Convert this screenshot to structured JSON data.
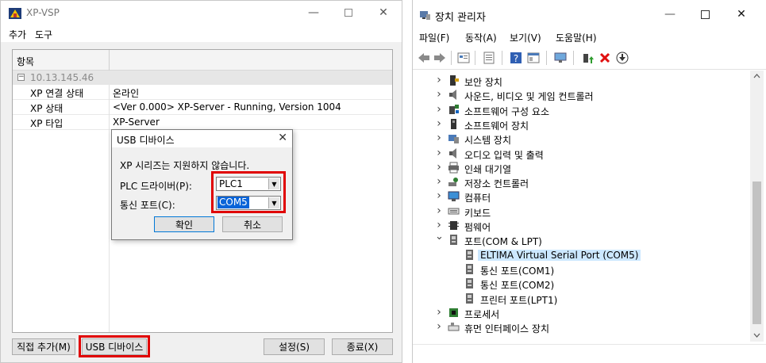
{
  "left": {
    "title": "XP-VSP",
    "menu": [
      "추가",
      "도구"
    ],
    "grid_header": "항목",
    "group": "10.13.145.46",
    "rows": [
      {
        "key": "XP 연결 상태",
        "value": "온라인"
      },
      {
        "key": "XP 상태",
        "value": "<Ver 0.000> XP-Server - Running, Version 1004"
      },
      {
        "key": "XP 타입",
        "value": "XP-Server"
      }
    ],
    "buttons": {
      "direct_add": "직접 추가(M)",
      "usb_device": "USB 디바이스",
      "settings": "설정(S)",
      "exit": "종료(X)"
    },
    "dialog": {
      "title": "USB 디바이스",
      "message": "XP 시리즈는 지원하지 않습니다.",
      "plc_label": "PLC 드라이버(P):",
      "plc_value": "PLC1",
      "port_label": "통신 포트(C):",
      "port_value": "COM5",
      "ok": "확인",
      "cancel": "취소"
    }
  },
  "right": {
    "title": "장치 관리자",
    "menu": [
      "파일(F)",
      "동작(A)",
      "보기(V)",
      "도움말(H)"
    ],
    "tree": [
      {
        "label": "보안 장치",
        "icon": "security-device-icon",
        "level": 0,
        "expand": "collapsed"
      },
      {
        "label": "사운드, 비디오 및 게임 컨트롤러",
        "icon": "speaker-icon",
        "level": 0,
        "expand": "collapsed"
      },
      {
        "label": "소프트웨어 구성 요소",
        "icon": "software-component-icon",
        "level": 0,
        "expand": "collapsed"
      },
      {
        "label": "소프트웨어 장치",
        "icon": "software-device-icon",
        "level": 0,
        "expand": "collapsed"
      },
      {
        "label": "시스템 장치",
        "icon": "system-device-icon",
        "level": 0,
        "expand": "collapsed"
      },
      {
        "label": "오디오 입력 및 출력",
        "icon": "speaker-icon",
        "level": 0,
        "expand": "collapsed"
      },
      {
        "label": "인쇄 대기열",
        "icon": "printer-icon",
        "level": 0,
        "expand": "collapsed"
      },
      {
        "label": "저장소 컨트롤러",
        "icon": "storage-controller-icon",
        "level": 0,
        "expand": "collapsed"
      },
      {
        "label": "컴퓨터",
        "icon": "monitor-icon",
        "level": 0,
        "expand": "collapsed"
      },
      {
        "label": "키보드",
        "icon": "keyboard-icon",
        "level": 0,
        "expand": "collapsed"
      },
      {
        "label": "펌웨어",
        "icon": "firmware-icon",
        "level": 0,
        "expand": "collapsed"
      },
      {
        "label": "포트(COM & LPT)",
        "icon": "port-icon",
        "level": 0,
        "expand": "expanded"
      },
      {
        "label": "ELTIMA Virtual Serial Port (COM5)",
        "icon": "port-icon",
        "level": 1,
        "selected": true
      },
      {
        "label": "통신 포트(COM1)",
        "icon": "port-icon",
        "level": 1
      },
      {
        "label": "통신 포트(COM2)",
        "icon": "port-icon",
        "level": 1
      },
      {
        "label": "프린터 포트(LPT1)",
        "icon": "port-icon",
        "level": 1
      },
      {
        "label": "프로세서",
        "icon": "processor-icon",
        "level": 0,
        "expand": "collapsed"
      },
      {
        "label": "휴먼 인터페이스 장치",
        "icon": "hid-icon",
        "level": 0,
        "expand": "collapsed"
      }
    ]
  },
  "colors": {
    "highlight_red": "#e00000",
    "selection_blue": "#cce8ff",
    "combo_selected": "#0a64d8"
  }
}
